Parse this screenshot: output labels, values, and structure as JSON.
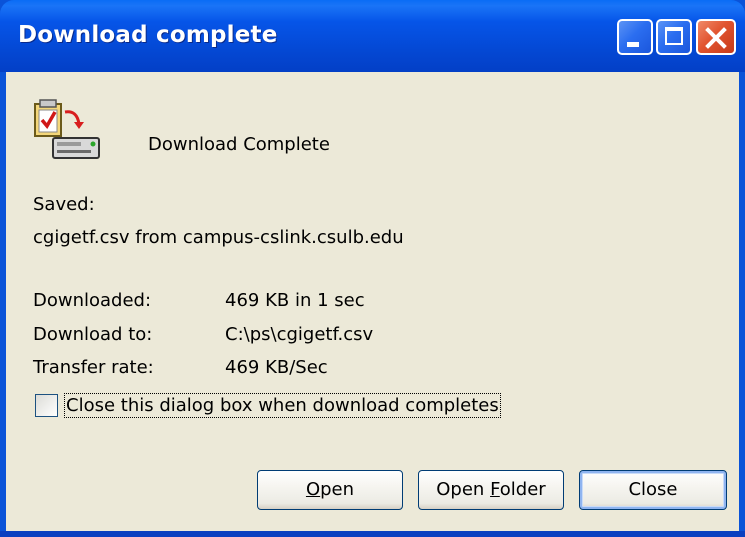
{
  "window": {
    "title": "Download complete",
    "controls": {
      "minimize": "minimize-icon",
      "maximize": "maximize-icon",
      "close": "close-icon"
    }
  },
  "dialog": {
    "icon": "download-complete-icon",
    "heading": "Download Complete",
    "saved_label": "Saved:",
    "saved_value": "cgigetf.csv from campus-cslink.csulb.edu",
    "downloaded_label": "Downloaded:",
    "downloaded_value": "469 KB in 1 sec",
    "download_to_label": "Download to:",
    "download_to_value": "C:\\ps\\cgigetf.csv",
    "transfer_rate_label": "Transfer rate:",
    "transfer_rate_value": "469 KB/Sec",
    "close_on_complete_label": "Close this dialog box when download completes",
    "close_on_complete_checked": false
  },
  "buttons": {
    "open": {
      "accel": "O",
      "rest": "pen"
    },
    "open_folder": {
      "before": "Open ",
      "accel": "F",
      "rest": "older"
    },
    "close": "Close"
  },
  "colors": {
    "titlebar": "#0655e8",
    "client": "#ece9d8",
    "close_button": "#e1542f"
  }
}
